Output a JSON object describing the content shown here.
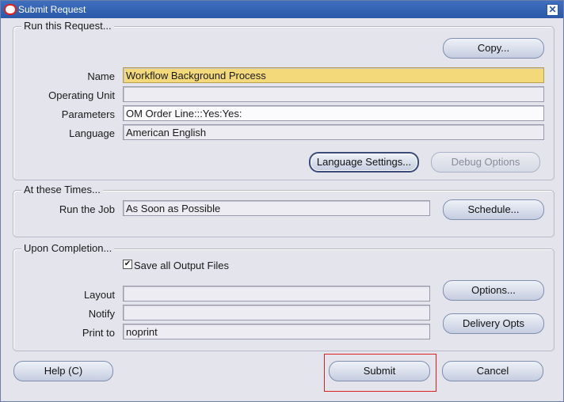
{
  "window": {
    "title": "Submit Request",
    "close_label": "✕"
  },
  "run_request": {
    "group_title": "Run this Request...",
    "copy_label": "Copy...",
    "name_label": "Name",
    "name_value": "Workflow Background Process",
    "operating_unit_label": "Operating Unit",
    "operating_unit_value": "",
    "parameters_label": "Parameters",
    "parameters_value": "OM Order Line:::Yes:Yes:",
    "language_label": "Language",
    "language_value": "American English",
    "language_settings_label": "Language Settings...",
    "debug_options_label": "Debug Options"
  },
  "schedule": {
    "group_title": "At these Times...",
    "run_job_label": "Run the Job",
    "run_job_value": "As Soon as Possible",
    "schedule_label": "Schedule..."
  },
  "completion": {
    "group_title": "Upon Completion...",
    "save_output_label": "Save all Output Files",
    "save_output_checked": true,
    "layout_label": "Layout",
    "layout_value": "",
    "notify_label": "Notify",
    "notify_value": "",
    "print_to_label": "Print to",
    "print_to_value": "noprint",
    "options_label": "Options...",
    "delivery_opts_label": "Delivery Opts"
  },
  "footer": {
    "help_label": "Help (C)",
    "submit_label": "Submit",
    "cancel_label": "Cancel"
  },
  "colors": {
    "required_field": "#f4d97a",
    "titlebar": "#2b59a8",
    "highlight": "#e02020"
  }
}
